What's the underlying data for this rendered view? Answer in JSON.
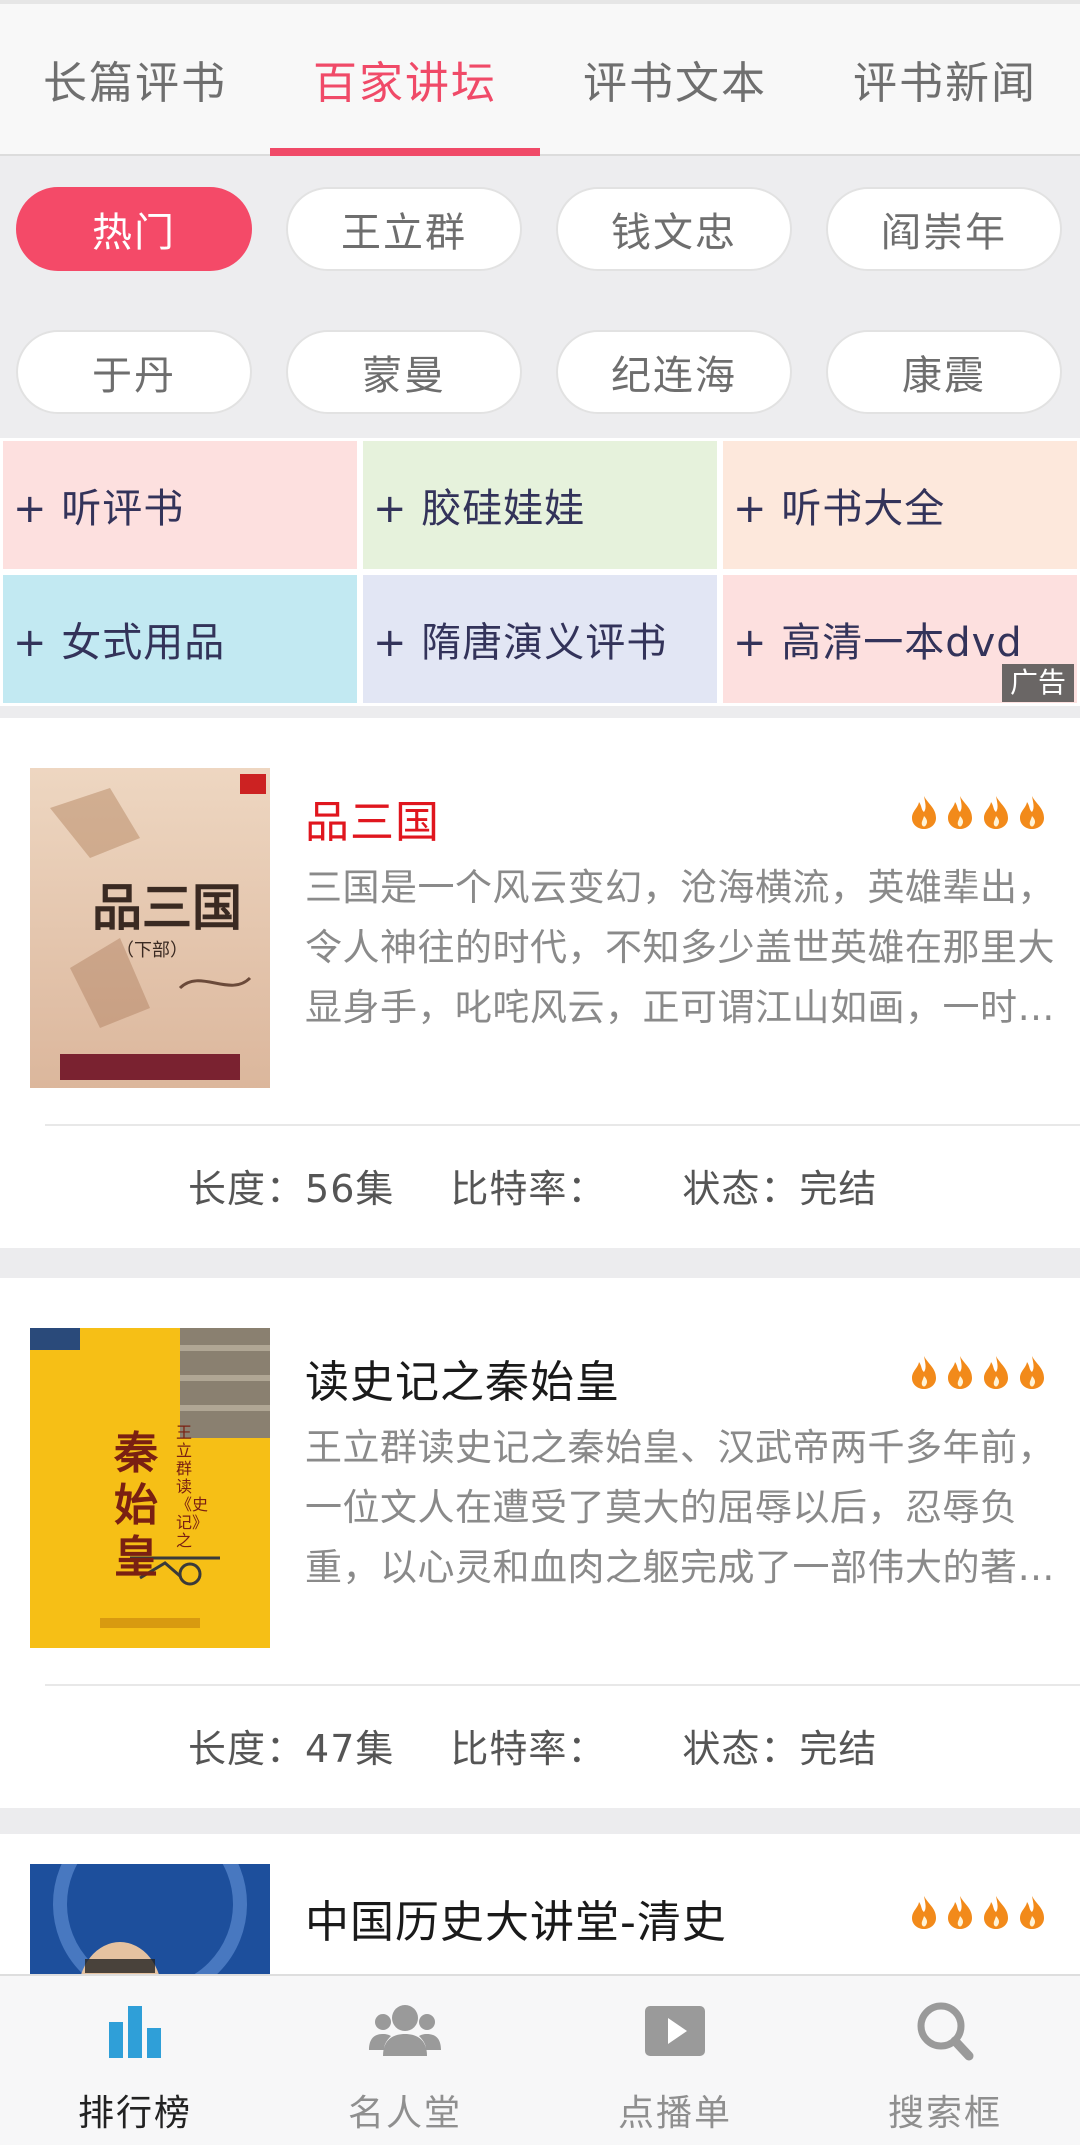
{
  "tabs": [
    {
      "label": "长篇评书"
    },
    {
      "label": "百家讲坛"
    },
    {
      "label": "评书文本"
    },
    {
      "label": "评书新闻"
    }
  ],
  "active_tab": "百家讲坛",
  "chips": [
    {
      "label": "热门"
    },
    {
      "label": "王立群"
    },
    {
      "label": "钱文忠"
    },
    {
      "label": "阎崇年"
    },
    {
      "label": "于丹"
    },
    {
      "label": "蒙曼"
    },
    {
      "label": "纪连海"
    },
    {
      "label": "康震"
    }
  ],
  "active_chip": "热门",
  "ads": [
    {
      "label": "+ 听评书",
      "bg": "#fde0df"
    },
    {
      "label": "+ 胶硅娃娃",
      "bg": "#e6f2dc"
    },
    {
      "label": "+ 听书大全",
      "bg": "#fde8dc"
    },
    {
      "label": "+ 女式用品",
      "bg": "#c2e9f2"
    },
    {
      "label": "+ 隋唐演义评书",
      "bg": "#e2e6f4"
    },
    {
      "label": "+ 高清一本dvd",
      "bg": "#fde0df"
    }
  ],
  "ad_badge": "广告",
  "books": [
    {
      "title": "品三国",
      "title_color": "#e0161e",
      "rating": 4,
      "description": "三国是一个风云变幻，沧海横流，英雄辈出，令人神往的时代，不知多少盖世英雄在那里大显身手，叱咤风云，正可谓江山如画，一时多少豪杰。",
      "length_label": "长度：",
      "length": "56集",
      "bitrate_label": "比特率：",
      "bitrate": "",
      "status_label": "状态：",
      "status": "完结",
      "cover_text": "品三国",
      "cover_sub": "（下部）"
    },
    {
      "title": "读史记之秦始皇",
      "title_color": "#1a1a1a",
      "rating": 4,
      "description": "王立群读史记之秦始皇、汉武帝两千多年前，一位文人在遭受了莫大的屈辱以后，忍辱负重，以心灵和血肉之躯完成了一部伟大的著作。",
      "length_label": "长度：",
      "length": "47集",
      "bitrate_label": "比特率：",
      "bitrate": "",
      "status_label": "状态：",
      "status": "完结",
      "cover_text": "秦始皇",
      "cover_sub": "王立群读《史记》之"
    },
    {
      "title": "中国历史大讲堂-清史",
      "title_color": "#1a1a1a",
      "rating": 4
    }
  ],
  "bottom_nav": [
    {
      "label": "排行榜",
      "icon": "bar-chart-icon"
    },
    {
      "label": "名人堂",
      "icon": "people-icon"
    },
    {
      "label": "点播单",
      "icon": "play-icon"
    },
    {
      "label": "搜索框",
      "icon": "search-icon"
    }
  ],
  "active_nav": "排行榜",
  "colors": {
    "accent": "#f04a68",
    "nav_active": "#2f9fd8",
    "nav_inactive": "#9a9a9a",
    "flame": "#f28a1a"
  }
}
